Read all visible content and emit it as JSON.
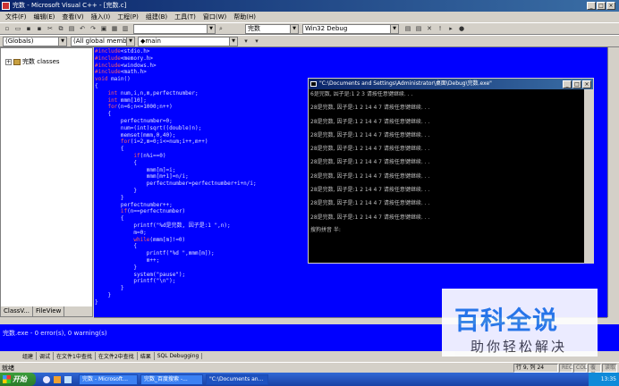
{
  "app": {
    "title": "完数 - Microsoft Visual C++ - [完数.c]"
  },
  "menu": [
    "文件(F)",
    "编辑(E)",
    "查看(V)",
    "插入(I)",
    "工程(P)",
    "组建(B)",
    "工具(T)",
    "窗口(W)",
    "帮助(H)"
  ],
  "toolbar": {
    "combo_find": "",
    "combo_search": "完数",
    "combo_config": "Win32 Debug"
  },
  "wizardbar": {
    "scope": "(Globals)",
    "members": "(All global members",
    "function": "main"
  },
  "workspace": {
    "tree_root": "完数 classes",
    "tabs": [
      "ClassV...",
      "FileView"
    ]
  },
  "code": [
    "#include<stdio.h>",
    "#include<memory.h>",
    "#include<windows.h>",
    "#include<math.h>",
    "void main()",
    "{",
    "    int num,i,n,m,perfectnumber;",
    "    int mmm[10];",
    "    for(n=6;n<=1000;n++)",
    "    {",
    "        perfectnumber=0;",
    "        num=(int)sqrt((double)n);",
    "        memset(mmm,0,40);",
    "        for(i=2,m=0;i<=num;i++,m++)",
    "        {",
    "            if(n%i==0)",
    "            {",
    "                mmm[m]=i;",
    "                mmm[m+1]=n/i;",
    "                perfectnumber=perfectnumber+i+n/i;",
    "            }",
    "        }",
    "        perfectnumber++;",
    "        if(n==perfectnumber)",
    "        {",
    "            printf(\"%d是完数, 因子是:1 \",n);",
    "            m=0;",
    "            while(mmm[m]!=0)",
    "            {",
    "                printf(\"%d \",mmm[m]);",
    "                m++;",
    "            }",
    "            system(\"pause\");",
    "            printf(\"\\n\");",
    "        }",
    "    }",
    "}"
  ],
  "console": {
    "title": "\"C:\\Documents and Settings\\Administrator\\桌面\\Debug\\完数.exe\"",
    "lines": [
      "6是完数, 因子是:1 2 3 请按任意键继续. . .",
      "28是完数, 因子是:1 2 14 4 7 请按任意键继续. . .",
      "28是完数, 因子是:1 2 14 4 7 请按任意键继续. . .",
      "28是完数, 因子是:1 2 14 4 7 请按任意键继续. . .",
      "28是完数, 因子是:1 2 14 4 7 请按任意键继续. . .",
      "28是完数, 因子是:1 2 14 4 7 请按任意键继续. . .",
      "28是完数, 因子是:1 2 14 4 7 请按任意键继续. . .",
      "28是完数, 因子是:1 2 14 4 7 请按任意键继续. . .",
      "28是完数, 因子是:1 2 14 4 7 请按任意键继续. . .",
      "28是完数, 因子是:1 2 14 4 7 请按任意键继续. . ."
    ],
    "ime": "搜狗拼音 半:"
  },
  "output": {
    "text": "完数.exe - 0 error(s), 0 warning(s)",
    "tabs": [
      "组建",
      "调试",
      "在文件1中查找",
      "在文件2中查找",
      "结果",
      "SQL Debugging"
    ]
  },
  "statusbar": {
    "left": "就绪",
    "position": "行 9, 列 24",
    "rec": "REC",
    "col": "COL",
    "ovr": "覆盖",
    "read": "读取"
  },
  "taskbar": {
    "start": "开始",
    "buttons": [
      "完数 - Microsoft...",
      "完数_百度搜索 -...",
      "\"C:\\Documents an..."
    ],
    "time": "13:35"
  },
  "watermark": {
    "big": "百科全说",
    "small": "助你轻松解决"
  },
  "colors": {
    "editor_bg": "#0000ff",
    "keyword": "#ff6060",
    "titlebar": "#0a246a",
    "taskbar": "#3168d5"
  }
}
